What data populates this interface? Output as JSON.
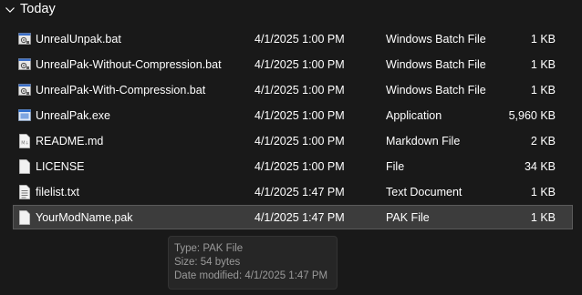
{
  "group": {
    "title": "Today"
  },
  "files": [
    {
      "name": "UnrealUnpak.bat",
      "date": "4/1/2025 1:00 PM",
      "type": "Windows Batch File",
      "size": "1 KB",
      "icon": "batch-file-icon",
      "selected": false
    },
    {
      "name": "UnrealPak-Without-Compression.bat",
      "date": "4/1/2025 1:00 PM",
      "type": "Windows Batch File",
      "size": "1 KB",
      "icon": "batch-file-icon",
      "selected": false
    },
    {
      "name": "UnrealPak-With-Compression.bat",
      "date": "4/1/2025 1:00 PM",
      "type": "Windows Batch File",
      "size": "1 KB",
      "icon": "batch-file-icon",
      "selected": false
    },
    {
      "name": "UnrealPak.exe",
      "date": "4/1/2025 1:00 PM",
      "type": "Application",
      "size": "5,960 KB",
      "icon": "application-icon",
      "selected": false
    },
    {
      "name": "README.md",
      "date": "4/1/2025 1:00 PM",
      "type": "Markdown File",
      "size": "2 KB",
      "icon": "markdown-file-icon",
      "selected": false
    },
    {
      "name": "LICENSE",
      "date": "4/1/2025 1:00 PM",
      "type": "File",
      "size": "34 KB",
      "icon": "blank-file-icon",
      "selected": false
    },
    {
      "name": "filelist.txt",
      "date": "4/1/2025 1:47 PM",
      "type": "Text Document",
      "size": "1 KB",
      "icon": "text-file-icon",
      "selected": false
    },
    {
      "name": "YourModName.pak",
      "date": "4/1/2025 1:47 PM",
      "type": "PAK File",
      "size": "1 KB",
      "icon": "blank-file-icon",
      "selected": true
    }
  ],
  "tooltip": {
    "type_line": "Type: PAK File",
    "size_line": "Size: 54 bytes",
    "date_line": "Date modified: 4/1/2025 1:47 PM"
  },
  "colors": {
    "background": "#191919",
    "selected_row": "#3c3c3c",
    "batch_icon_accent": "#3b6fc9",
    "app_icon_accent": "#2f6fd0",
    "tooltip_text": "#9a9a9a"
  }
}
